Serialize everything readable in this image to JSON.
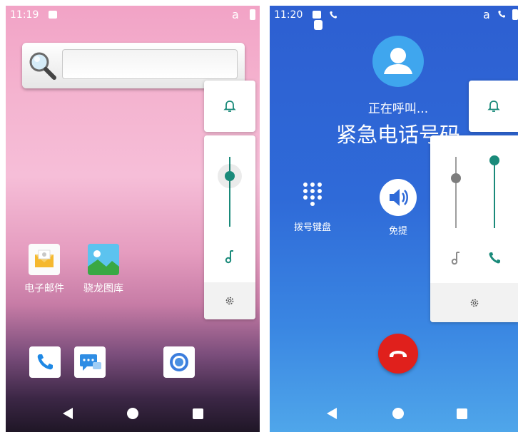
{
  "left_screen": {
    "status": {
      "time": "11:19",
      "carrier_letter": "a"
    },
    "search_widget": {
      "placeholder": ""
    },
    "apps": [
      {
        "label": "电子邮件",
        "icon": "email-icon"
      },
      {
        "label": "骁龙图库",
        "icon": "gallery-icon"
      }
    ],
    "dock": [
      "phone-icon",
      "messages-icon",
      "browser-icon"
    ],
    "volume_panel": {
      "level": 0.6,
      "accent": "#1a8a7a"
    }
  },
  "right_screen": {
    "status": {
      "time": "11:20",
      "carrier_letter": "a"
    },
    "call_status": "正在呼叫...",
    "call_target": "紧急电话号码",
    "actions": [
      {
        "label": "拨号键盘",
        "icon": "dialpad-icon"
      },
      {
        "label": "免提",
        "icon": "speaker-icon"
      }
    ],
    "volume_panel": {
      "media_level": 0.62,
      "call_level": 0.95,
      "accent": "#1a8a7a"
    },
    "end_call_color": "#e0201c"
  }
}
